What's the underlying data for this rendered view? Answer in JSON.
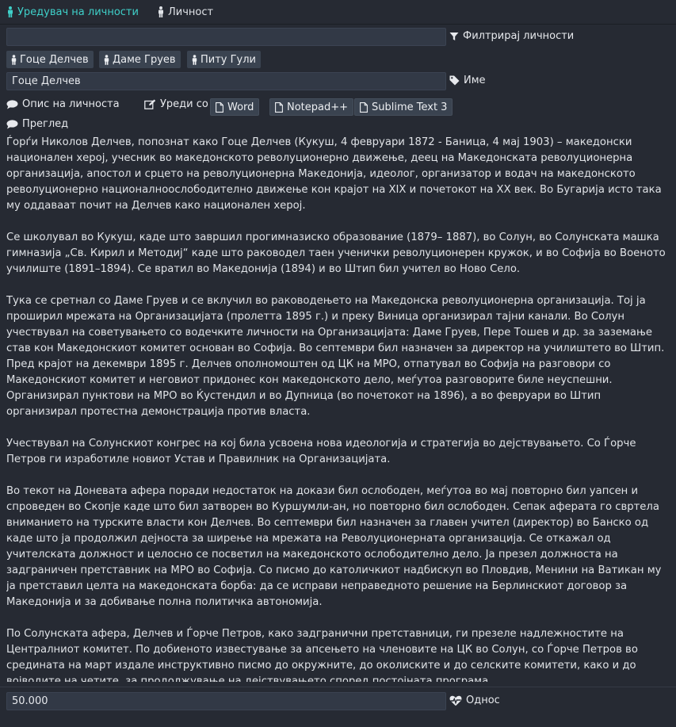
{
  "tabs": [
    {
      "label": "Уредувач на личности",
      "active": true
    },
    {
      "label": "Личност",
      "active": false
    }
  ],
  "filter": {
    "value": "",
    "label": "Филтрирај личности"
  },
  "people": [
    "Гоце Делчев",
    "Даме Груев",
    "Питу Гули"
  ],
  "name": {
    "value": "Гоце Делчев",
    "label": "Име"
  },
  "description_label": "Опис на личноста",
  "edit_with": {
    "label": "Уреди со",
    "editors": [
      "Word",
      "Notepad++",
      "Sublime Text 3"
    ]
  },
  "preview_label": "Преглед",
  "description": [
    "Ѓорѓи Николов Делчев, попознат како Гоце Делчев (Кукуш, 4 февруари 1872 - Баница, 4 мај 1903) – македонски национален херој, учесник во македонското револуционерно движење, деец на Македонската револуционерна организација, апостол и срцето на револуционерна Македонија, идеолог, организатор и водач на македонското револуционерно националноослободително движење кон крајот на XIX и почетокот на XX век. Во Бугарија исто така му оддаваат почит на Делчев како национален херој.",
    "Се школувал во Кукуш, каде што завршил прогимназиско образование (1879– 1887), во Солун, во Солунската машка гимназија „Св. Кирил и Методиј“ каде што раководел таен ученички револуционерен кружок, и во Софија во Военото училиште (1891–1894). Се вратил во Македонија (1894) и во Штип бил учител во Ново Село.",
    "Тука се сретнал со Даме Груев и се вклучил во раководењето на Македонска револуционерна организација. Тој ја проширил мрежата на Организацијата (пролетта 1895 г.) и преку Виница организирал тајни канали. Во Солун учествувал на советувањето со водечките личности на Организацијата: Даме Груев, Пере Тошев и др. за заземање став кон Македонскиот комитет основан во Софија. Во септември бил назначен за директор на училиштето во Штип. Пред крајот на декември 1895 г. Делчев ополномоштен од ЦК на МРО, отпатувал во Софија на разговори со Македонскиот комитет и неговиот придонес кон македонското дело, меѓутоа разговорите биле неуспешни. Организирал пунктови на МРО во Ќустендил и во Дупница (во почетокот на 1896), а во февруари во Штип организирал протестна демонстрација против власта.",
    "Учествувал на Солунскиот конгрес на кој била усвоена нова идеологија и стратегија во дејствувањето. Со Ѓорче Петров ги изработиле новиот Устав и Правилник на Организацијата.",
    "Во текот на Доневата афера поради недостаток на докази бил ослободен, меѓутоа во мај повторно бил уапсен и спроведен во Скопје каде што бил затворен во Куршумли-ан, но повторно бил ослободен. Сепак аферата го свртела вниманието на турските власти кон Делчев. Во септември бил назначен за главен учител (директор) во Банско од каде што ја продолжил дејноста за ширење на мрежата на Револуционерната организација. Се откажал од учителската должност и целосно се посветил на македонското ослободително дело. Ја презел должноста на задграничен претставник на МРО во Софија. Со писмо до католичкиот надбискуп во Пловдив, Менини на Ватикан му ја претставил целта на македонската борба: да се исправи неправедното решение на Берлинскиот договор за Македонија и за добивање полна политичка автономија.",
    "По Солунската афера, Делчев и Ѓорче Петров, како задгранични претставници, ги презеле надлежностите на Централниот комитет. По добиеното известување за апсењето на членовите на ЦК во Солун, со Ѓорче Петров во средината на март издале инструктивно писмо до окружните, до околиските и до селските комитети, како и до војводите на четите, за продолжување на дејствувањето според постојната програма."
  ],
  "relation": {
    "value": "50.000",
    "label": "Однос"
  },
  "colors": {
    "accent": "#3fd0c9",
    "background": "#262a33",
    "field": "#323946",
    "button": "#3a4350"
  },
  "icons": [
    "person-icon",
    "filter-icon",
    "tag-icon",
    "comment-icon",
    "edit-icon",
    "file-icon",
    "heartbeat-icon"
  ]
}
